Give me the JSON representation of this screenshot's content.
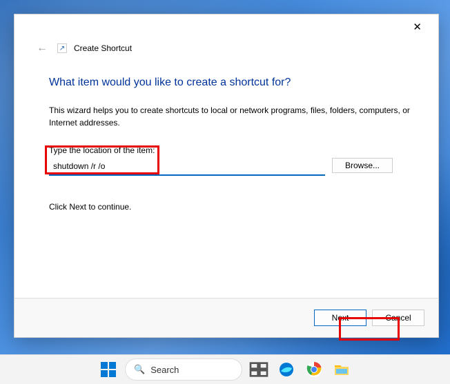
{
  "wizard": {
    "title": "Create Shortcut",
    "heading": "What item would you like to create a shortcut for?",
    "description": "This wizard helps you to create shortcuts to local or network programs, files, folders, computers, or Internet addresses.",
    "input_label": "Type the location of the item:",
    "input_value": "shutdown /r /o",
    "browse_label": "Browse...",
    "continue_text": "Click Next to continue.",
    "next_label": "Next",
    "cancel_label": "Cancel",
    "close_glyph": "✕",
    "back_glyph": "←",
    "shortcut_glyph": "↗"
  },
  "taskbar": {
    "search_label": "Search",
    "search_glyph": "🔍"
  }
}
